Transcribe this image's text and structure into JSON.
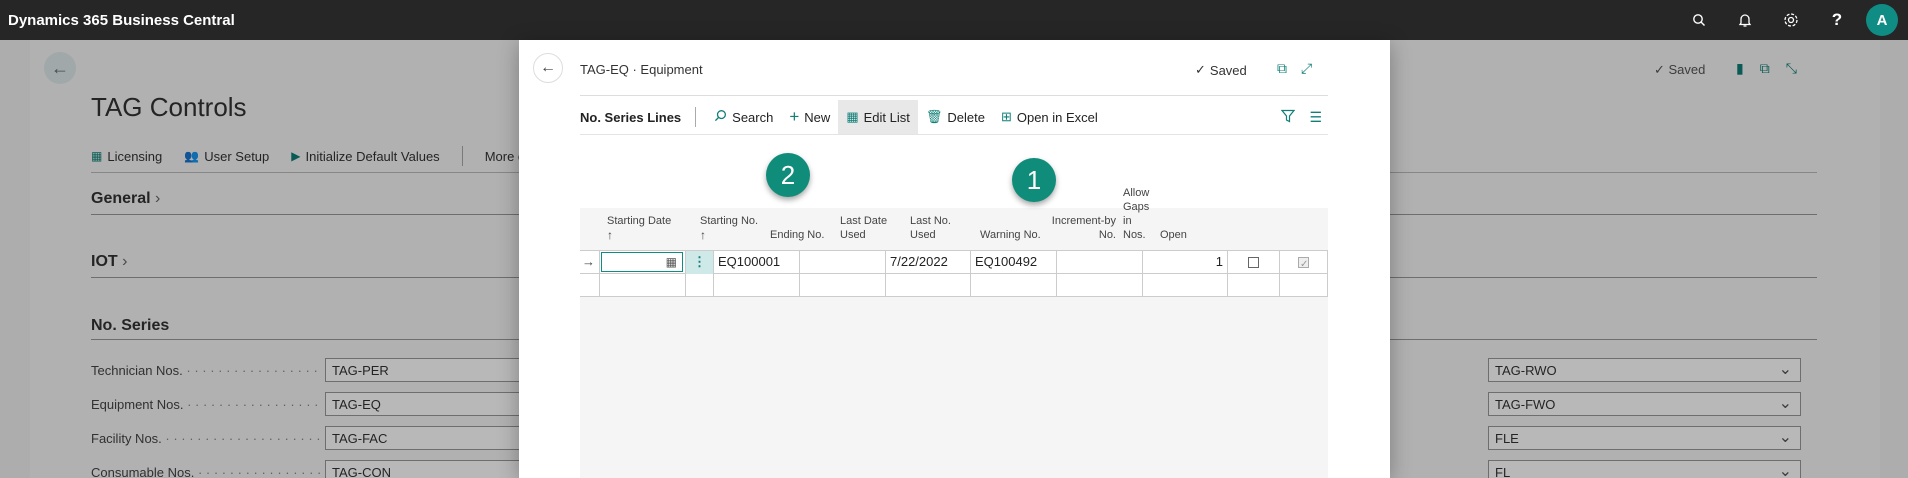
{
  "app": {
    "title": "Dynamics 365 Business Central",
    "avatar_initial": "A"
  },
  "topbar_icons": [
    "search-icon",
    "bell-icon",
    "gear-icon",
    "help-icon"
  ],
  "background_page": {
    "title": "TAG Controls",
    "saved_label": "Saved",
    "actions": [
      {
        "label": "Licensing",
        "icon": "license-icon"
      },
      {
        "label": "User Setup",
        "icon": "users-icon"
      },
      {
        "label": "Initialize Default Values",
        "icon": "play-icon"
      },
      {
        "label": "More options",
        "icon": ""
      }
    ],
    "sections": [
      "General",
      "IOT",
      "No. Series"
    ],
    "fields_left": [
      {
        "label": "Technician Nos.",
        "value": "TAG-PER"
      },
      {
        "label": "Equipment Nos.",
        "value": "TAG-EQ"
      },
      {
        "label": "Facility Nos.",
        "value": "TAG-FAC"
      },
      {
        "label": "Consumable Nos.",
        "value": "TAG-CON"
      }
    ],
    "fields_right": [
      {
        "value": "TAG-RWO"
      },
      {
        "value": "TAG-FWO"
      },
      {
        "value": "FLE"
      },
      {
        "value": "FL"
      }
    ]
  },
  "modal": {
    "title": "TAG-EQ · Equipment",
    "saved_label": "Saved",
    "toolbar": {
      "title": "No. Series Lines",
      "search": "Search",
      "new": "New",
      "edit_list": "Edit List",
      "delete": "Delete",
      "open_excel": "Open in Excel"
    },
    "columns": {
      "starting_date": "Starting Date",
      "starting_no": "Starting No.",
      "ending_no": "Ending No.",
      "last_date_used": "Last Date Used",
      "last_no_used": "Last No. Used",
      "warning_no": "Warning No.",
      "increment_by": "Increment-by No.",
      "allow_gaps": "Allow Gaps in Nos.",
      "open": "Open"
    },
    "rows": [
      {
        "starting_date": "",
        "starting_no": "EQ100001",
        "ending_no": "",
        "last_date_used": "7/22/2022",
        "last_no_used": "EQ100492",
        "warning_no": "",
        "increment_by": "1",
        "allow_gaps": false,
        "open": true
      }
    ],
    "badges": {
      "one": "1",
      "two": "2"
    }
  },
  "colors": {
    "accent": "#0f8c7a",
    "topbar": "#262626"
  }
}
